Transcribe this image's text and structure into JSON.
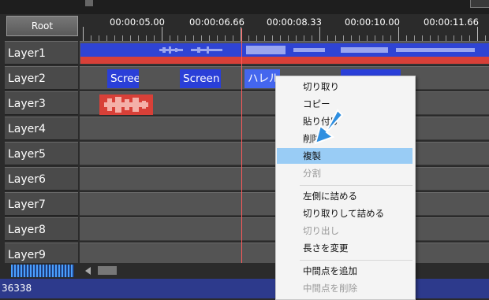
{
  "root_button": "Root",
  "ruler": {
    "labels": [
      "00:00:05.00",
      "00:00:06.66",
      "00:00:08.33",
      "00:00:10.00",
      "00:00:11.66"
    ]
  },
  "layers": [
    "Layer1",
    "Layer2",
    "Layer3",
    "Layer4",
    "Layer5",
    "Layer6",
    "Layer7",
    "Layer8",
    "Layer9"
  ],
  "clips": {
    "screen_1": "Scree",
    "screen_2": "Screen",
    "harel": "ハレル"
  },
  "context_menu": {
    "items": [
      {
        "label": "切り取り",
        "enabled": true
      },
      {
        "label": "コピー",
        "enabled": true
      },
      {
        "label": "貼り付け",
        "enabled": true
      },
      {
        "label": "削除",
        "enabled": true
      },
      {
        "label": "複製",
        "enabled": true,
        "highlighted": true
      },
      {
        "label": "分割",
        "enabled": false
      },
      {
        "label": "左側に詰める",
        "enabled": true
      },
      {
        "label": "切り取りして詰める",
        "enabled": true
      },
      {
        "label": "切り出し",
        "enabled": false
      },
      {
        "label": "長さを変更",
        "enabled": true
      },
      {
        "label": "中間点を追加",
        "enabled": true
      },
      {
        "label": "中間点を削除",
        "enabled": false
      }
    ]
  },
  "status_text": "36338",
  "colors": {
    "playhead": "#ff5a5a",
    "clip_blue": "#2a3fd8",
    "audio_red": "#d84038",
    "menu_highlight": "#99ccf5",
    "pointer_arrow": "#2f8fe0"
  }
}
